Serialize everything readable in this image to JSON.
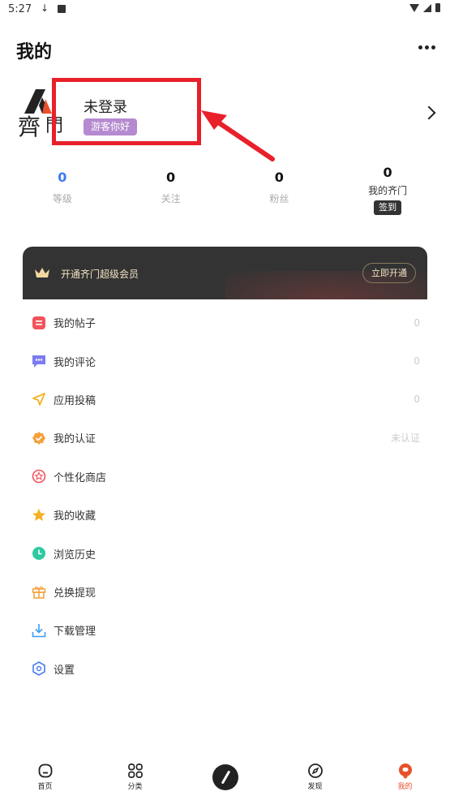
{
  "status_bar": {
    "time": "5:27",
    "download_glyph": "↓"
  },
  "header": {
    "title": "我的"
  },
  "profile": {
    "name": "未登录",
    "badge": "游客你好"
  },
  "stats": [
    {
      "value": "0",
      "label": "等级"
    },
    {
      "value": "0",
      "label": "关注"
    },
    {
      "value": "0",
      "label": "粉丝"
    },
    {
      "value": "0",
      "label": "我的齐门",
      "button": "签到"
    }
  ],
  "vip": {
    "text": "开通齐门超级会员",
    "button": "立即开通"
  },
  "menu": [
    {
      "label": "我的帖子",
      "value": "0",
      "icon": "post-icon",
      "color": "#f2545b"
    },
    {
      "label": "我的评论",
      "value": "0",
      "icon": "comment-icon",
      "color": "#7b7cf0"
    },
    {
      "label": "应用投稿",
      "value": "0",
      "icon": "submit-icon",
      "color": "#f5b025"
    },
    {
      "label": "我的认证",
      "value": "未认证",
      "icon": "verify-icon",
      "color": "#f5a03c"
    },
    {
      "label": "个性化商店",
      "value": "",
      "icon": "store-icon",
      "color": "#f2545b"
    },
    {
      "label": "我的收藏",
      "value": "",
      "icon": "star-icon",
      "color": "#f5b025"
    },
    {
      "label": "浏览历史",
      "value": "",
      "icon": "history-icon",
      "color": "#2ec9a0"
    },
    {
      "label": "兑换提现",
      "value": "",
      "icon": "gift-icon",
      "color": "#f5a03c"
    },
    {
      "label": "下载管理",
      "value": "",
      "icon": "download-icon",
      "color": "#3b9cf2"
    },
    {
      "label": "设置",
      "value": "",
      "icon": "settings-icon",
      "color": "#4a7cf0"
    }
  ],
  "tabbar": [
    {
      "label": "首页",
      "icon": "home-icon"
    },
    {
      "label": "分类",
      "icon": "category-icon"
    },
    {
      "label": "",
      "icon": "create-icon"
    },
    {
      "label": "发现",
      "icon": "discover-icon"
    },
    {
      "label": "我的",
      "icon": "profile-icon",
      "active": true
    }
  ],
  "colors": {
    "accent": "#3b7bf2",
    "highlight": "#e8202a",
    "active_tab": "#e8502a",
    "badge": "#b68ad0"
  }
}
